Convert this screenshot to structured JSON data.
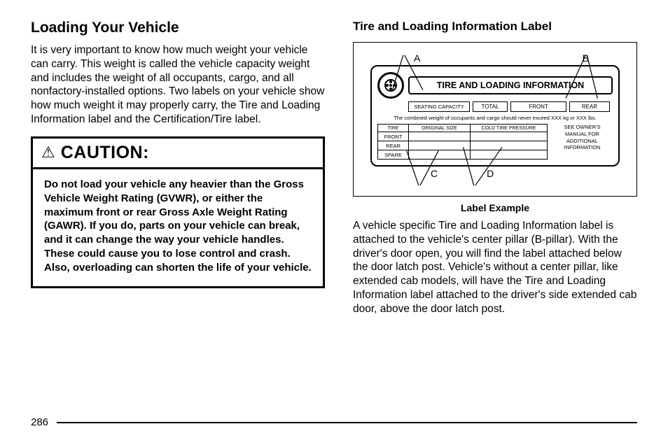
{
  "page_number": "286",
  "left": {
    "heading": "Loading Your Vehicle",
    "para": "It is very important to know how much weight your vehicle can carry. This weight is called the vehicle capacity weight and includes the weight of all occupants, cargo, and all nonfactory-installed options. Two labels on your vehicle show how much weight it may properly carry, the Tire and Loading Information label and the Certification/Tire label.",
    "caution_title": "CAUTION:",
    "caution_body": "Do not load your vehicle any heavier than the Gross Vehicle Weight Rating (GVWR), or either the maximum front or rear Gross Axle Weight Rating (GAWR). If you do, parts on your vehicle can break, and it can change the way your vehicle handles. These could cause you to lose control and crash. Also, overloading can shorten the life of your vehicle."
  },
  "right": {
    "heading": "Tire and Loading Information Label",
    "caption": "Label Example",
    "para": "A vehicle specific Tire and Loading Information label is attached to the vehicle's center pillar (B-pillar). With the driver's door open, you will find the label attached below the door latch post. Vehicle's without a center pillar, like extended cab models, will have the Tire and Loading Information label attached to the driver's side extended cab door, above the door latch post."
  },
  "label_diagram": {
    "markers": {
      "A": "A",
      "B": "B",
      "C": "C",
      "D": "D"
    },
    "banner": "TIRE AND LOADING INFORMATION",
    "seating": {
      "label": "SEATING CAPACITY",
      "total": "TOTAL",
      "front": "FRONT",
      "rear": "REAR"
    },
    "weight_line": "The combined weight of occupants and cargo should never exceed  XXX kg or XXX lbs.",
    "tire_table": {
      "h_tire": "TIRE",
      "h_size": "ORIGINAL SIZE",
      "h_press": "COLD TIRE PRESSURE",
      "rows": [
        "FRONT",
        "REAR",
        "SPARE"
      ]
    },
    "owners": {
      "l1": "SEE OWNER'S",
      "l2": "MANUAL FOR",
      "l3": "ADDITIONAL",
      "l4": "INFORMATION"
    }
  }
}
